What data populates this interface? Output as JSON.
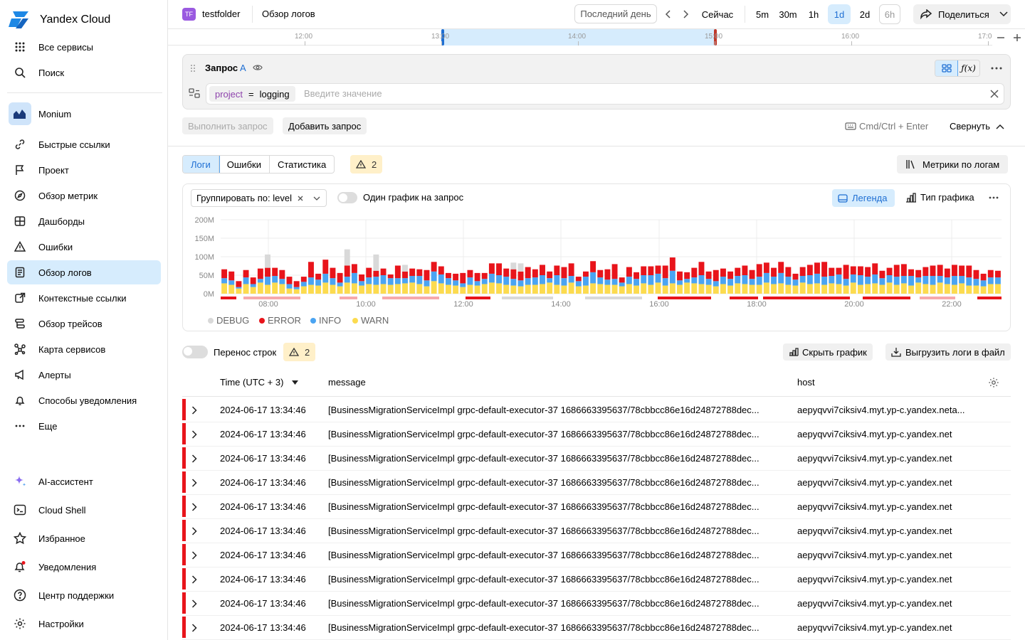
{
  "brand": {
    "name": "Yandex Cloud"
  },
  "sidebar": {
    "top": [
      {
        "label": "Все сервисы",
        "icon": "grid-icon"
      },
      {
        "label": "Поиск",
        "icon": "search-icon"
      }
    ],
    "service": {
      "label": "Monium",
      "icon": "monium-icon"
    },
    "items": [
      {
        "label": "Быстрые ссылки",
        "icon": "link-icon"
      },
      {
        "label": "Проект",
        "icon": "flag-icon"
      },
      {
        "label": "Обзор метрик",
        "icon": "compass-icon"
      },
      {
        "label": "Дашборды",
        "icon": "dashboard-icon"
      },
      {
        "label": "Ошибки",
        "icon": "warning-icon"
      },
      {
        "label": "Обзор логов",
        "icon": "logs-icon",
        "active": true
      },
      {
        "label": "Контекстные ссылки",
        "icon": "context-link-icon"
      },
      {
        "label": "Обзор трейсов",
        "icon": "traces-icon"
      },
      {
        "label": "Карта сервисов",
        "icon": "service-map-icon"
      },
      {
        "label": "Алерты",
        "icon": "megaphone-icon"
      },
      {
        "label": "Способы уведомления",
        "icon": "bell-icon"
      },
      {
        "label": "Еще",
        "icon": "more-icon"
      }
    ],
    "bottom": [
      {
        "label": "AI-ассистент",
        "icon": "sparkle-icon"
      },
      {
        "label": "Cloud Shell",
        "icon": "terminal-icon"
      },
      {
        "label": "Избранное",
        "icon": "star-icon"
      },
      {
        "label": "Уведомления",
        "icon": "bell-dot-icon"
      },
      {
        "label": "Центр поддержки",
        "icon": "help-icon"
      },
      {
        "label": "Настройки",
        "icon": "gear-icon"
      }
    ]
  },
  "topbar": {
    "folder_badge": "TF",
    "folder": "testfolder",
    "page": "Обзор логов",
    "range": "Последний день",
    "now": "Сейчас",
    "presets": [
      "5m",
      "30m",
      "1h",
      "1d",
      "2d",
      "6h"
    ],
    "active_preset": "1d",
    "share": "Поделиться"
  },
  "timeline": {
    "labels": [
      "12:00",
      "13:00",
      "14:00",
      "15:00",
      "16:00",
      "17:0"
    ]
  },
  "query": {
    "title": "Запрос",
    "letter": "A",
    "chip_key": "project",
    "chip_op": "=",
    "chip_value": "logging",
    "placeholder": "Введите значение",
    "run": "Выполнить запрос",
    "add": "Добавить запрос",
    "shortcut": "Cmd/Ctrl + Enter",
    "collapse": "Свернуть"
  },
  "tabs": {
    "items": [
      "Логи",
      "Ошибки",
      "Статистика"
    ],
    "active": "Логи",
    "warnings": "2",
    "metrics_button": "Метрики по логам"
  },
  "chart_controls": {
    "group_by": "Группировать по: level",
    "one_per_query": "Один график на запрос",
    "legend": "Легенда",
    "chart_type": "Тип графика"
  },
  "colors": {
    "DEBUG": "#d9d9d9",
    "ERROR": "#e8141b",
    "INFO": "#4aa4f2",
    "WARN": "#fcdb4f",
    "accent": "#1f6fd3"
  },
  "chart_data": {
    "type": "bar",
    "stacked": true,
    "ylim": [
      0,
      200
    ],
    "y_tick_labels": [
      "0M",
      "50M",
      "100M",
      "150M",
      "200M"
    ],
    "x_tick_labels": [
      "08:00",
      "10:00",
      "12:00",
      "14:00",
      "16:00",
      "18:00",
      "20:00",
      "22:00"
    ],
    "legend": [
      "DEBUG",
      "ERROR",
      "INFO",
      "WARN"
    ],
    "legend_position": "bottom-left",
    "series": [
      {
        "name": "WARN",
        "values": [
          28,
          24,
          14,
          26,
          18,
          30,
          24,
          30,
          26,
          14,
          12,
          20,
          24,
          22,
          30,
          24,
          20,
          30,
          28,
          22,
          26,
          24,
          26,
          24,
          26,
          28,
          30,
          26,
          20,
          34,
          28,
          24,
          22,
          18,
          24,
          22,
          26,
          30,
          28,
          24,
          22,
          20,
          24,
          24,
          26,
          30,
          24,
          22,
          30,
          20,
          22,
          28,
          26,
          24,
          24,
          20,
          26,
          22,
          28,
          24,
          30,
          22,
          28,
          24,
          30,
          28,
          26,
          24,
          20,
          26,
          22,
          28,
          26,
          24,
          24,
          30,
          26,
          28,
          24,
          22,
          30,
          26,
          28,
          24,
          28,
          26,
          22,
          30,
          24,
          26,
          28,
          24,
          30,
          24,
          28,
          22,
          30,
          26,
          24,
          30,
          26,
          24,
          28,
          22,
          22,
          20,
          26,
          26
        ]
      },
      {
        "name": "INFO",
        "values": [
          14,
          12,
          4,
          18,
          8,
          10,
          22,
          18,
          14,
          12,
          6,
          12,
          20,
          16,
          24,
          18,
          10,
          16,
          28,
          12,
          18,
          22,
          24,
          18,
          16,
          14,
          18,
          22,
          16,
          26,
          24,
          18,
          14,
          10,
          20,
          12,
          14,
          24,
          22,
          22,
          18,
          16,
          18,
          20,
          24,
          12,
          26,
          20,
          18,
          14,
          24,
          30,
          18,
          14,
          16,
          10,
          20,
          18,
          22,
          26,
          24,
          20,
          34,
          12,
          10,
          16,
          24,
          16,
          14,
          20,
          18,
          20,
          24,
          16,
          22,
          26,
          20,
          28,
          22,
          16,
          18,
          24,
          26,
          22,
          20,
          26,
          18,
          22,
          26,
          20,
          24,
          18,
          20,
          22,
          20,
          26,
          14,
          22,
          24,
          18,
          18,
          24,
          20,
          22,
          18,
          16,
          18,
          18
        ]
      },
      {
        "name": "ERROR",
        "values": [
          24,
          24,
          16,
          20,
          18,
          28,
          24,
          22,
          24,
          20,
          16,
          14,
          42,
          16,
          38,
          28,
          26,
          30,
          24,
          18,
          26,
          16,
          18,
          10,
          34,
          18,
          20,
          18,
          28,
          26,
          22,
          14,
          18,
          28,
          20,
          22,
          16,
          28,
          32,
          22,
          26,
          24,
          30,
          22,
          28,
          18,
          26,
          30,
          34,
          12,
          14,
          30,
          20,
          28,
          40,
          14,
          26,
          18,
          24,
          24,
          22,
          34,
          36,
          24,
          18,
          26,
          36,
          20,
          30,
          22,
          20,
          22,
          26,
          24,
          34,
          28,
          24,
          30,
          26,
          16,
          24,
          28,
          30,
          40,
          22,
          18,
          38,
          22,
          24,
          26,
          30,
          20,
          20,
          32,
          32,
          18,
          20,
          24,
          28,
          30,
          24,
          30,
          28,
          32,
          24,
          18,
          20,
          18
        ]
      },
      {
        "name": "DEBUG",
        "values": [
          0,
          0,
          0,
          0,
          0,
          0,
          36,
          0,
          0,
          0,
          0,
          0,
          0,
          0,
          0,
          0,
          0,
          44,
          0,
          0,
          0,
          44,
          0,
          0,
          0,
          18,
          0,
          0,
          0,
          0,
          0,
          0,
          0,
          0,
          0,
          0,
          0,
          0,
          0,
          0,
          18,
          22,
          0,
          0,
          0,
          0,
          0,
          0,
          0,
          0,
          0,
          0,
          0,
          0,
          0,
          0,
          0,
          0,
          0,
          0,
          0,
          0,
          0,
          0,
          0,
          0,
          0,
          0,
          0,
          0,
          0,
          0,
          0,
          0,
          0,
          0,
          0,
          0,
          0,
          0,
          0,
          0,
          0,
          0,
          0,
          0,
          0,
          0,
          0,
          0,
          0,
          0,
          0,
          0,
          0,
          0,
          0,
          0,
          0,
          0,
          0,
          0,
          0,
          0,
          0,
          0,
          0,
          0
        ]
      }
    ]
  },
  "table": {
    "wrap_lines": "Перенос строк",
    "warnings": "2",
    "hide_chart": "Скрыть график",
    "export": "Выгрузить логи в файл",
    "columns": [
      "Time (UTC + 3)",
      "message",
      "host"
    ],
    "rows": [
      {
        "time": "2024-06-17 13:34:46",
        "message": "[BusinessMigrationServiceImpl grpc-default-executor-37 1686663395637/78cbbcc86e16d24872788dec...",
        "host": "aepyqvvi7ciksiv4.myt.yp-c.yandex.neta..."
      },
      {
        "time": "2024-06-17 13:34:46",
        "message": "[BusinessMigrationServiceImpl grpc-default-executor-37 1686663395637/78cbbcc86e16d24872788dec...",
        "host": "aepyqvvi7ciksiv4.myt.yp-c.yandex.net"
      },
      {
        "time": "2024-06-17 13:34:46",
        "message": "[BusinessMigrationServiceImpl grpc-default-executor-37 1686663395637/78cbbcc86e16d24872788dec...",
        "host": "aepyqvvi7ciksiv4.myt.yp-c.yandex.net"
      },
      {
        "time": "2024-06-17 13:34:46",
        "message": "[BusinessMigrationServiceImpl grpc-default-executor-37 1686663395637/78cbbcc86e16d24872788dec...",
        "host": "aepyqvvi7ciksiv4.myt.yp-c.yandex.net"
      },
      {
        "time": "2024-06-17 13:34:46",
        "message": "[BusinessMigrationServiceImpl grpc-default-executor-37 1686663395637/78cbbcc86e16d24872788dec...",
        "host": "aepyqvvi7ciksiv4.myt.yp-c.yandex.net"
      },
      {
        "time": "2024-06-17 13:34:46",
        "message": "[BusinessMigrationServiceImpl grpc-default-executor-37 1686663395637/78cbbcc86e16d24872788dec...",
        "host": "aepyqvvi7ciksiv4.myt.yp-c.yandex.net"
      },
      {
        "time": "2024-06-17 13:34:46",
        "message": "[BusinessMigrationServiceImpl grpc-default-executor-37 1686663395637/78cbbcc86e16d24872788dec...",
        "host": "aepyqvvi7ciksiv4.myt.yp-c.yandex.net"
      },
      {
        "time": "2024-06-17 13:34:46",
        "message": "[BusinessMigrationServiceImpl grpc-default-executor-37 1686663395637/78cbbcc86e16d24872788dec...",
        "host": "aepyqvvi7ciksiv4.myt.yp-c.yandex.net"
      },
      {
        "time": "2024-06-17 13:34:46",
        "message": "[BusinessMigrationServiceImpl grpc-default-executor-37 1686663395637/78cbbcc86e16d24872788dec...",
        "host": "aepyqvvi7ciksiv4.myt.yp-c.yandex.net"
      },
      {
        "time": "2024-06-17 13:34:46",
        "message": "[BusinessMigrationServiceImpl grpc-default-executor-37 1686663395637/78cbbcc86e16d24872788dec...",
        "host": "aepyqvvi7ciksiv4.myt.yp-c.yandex.net"
      }
    ]
  }
}
